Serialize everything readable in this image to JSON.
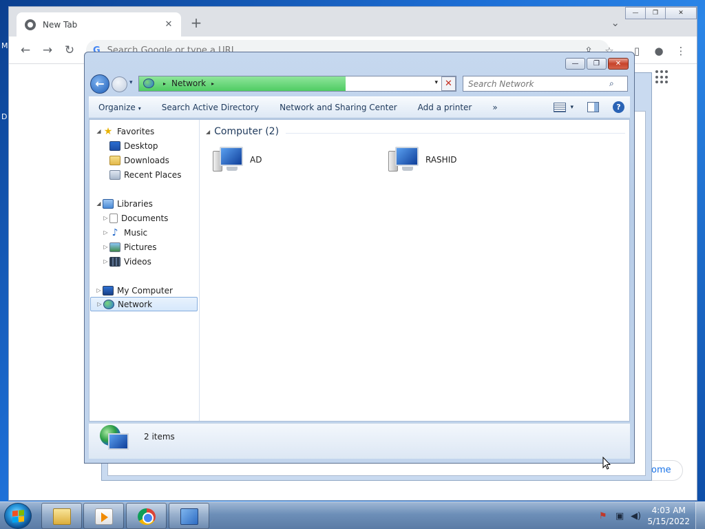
{
  "desktop": {
    "edge_text_top": "M",
    "edge_text_mid": "D"
  },
  "chrome": {
    "tab_title": "New Tab",
    "tab_close": "✕",
    "new_tab": "+",
    "tab_search": "⌄",
    "win_min": "—",
    "win_max": "❐",
    "win_close": "✕",
    "nav_back": "←",
    "nav_forward": "→",
    "nav_reload": "↻",
    "omnibox_placeholder": "Search Google or type a URL",
    "omnibox_g": "G",
    "share_icon": "⇪",
    "star_icon": "☆",
    "sidepanel_icon": "▯",
    "profile_icon": "●",
    "menu_icon": "⋮",
    "customize_label": "rome"
  },
  "explorer": {
    "win_min": "—",
    "win_max": "❐",
    "win_close": "✕",
    "back": "←",
    "history_caret": "▾",
    "address": {
      "location": "Network",
      "sep": "▸",
      "dropdown": "▾",
      "stop": "✕"
    },
    "search_placeholder": "Search Network",
    "search_icon": "⌕",
    "commands": {
      "organize": "Organize",
      "organize_caret": "▾",
      "search_ad": "Search Active Directory",
      "network_center": "Network and Sharing Center",
      "add_printer": "Add a printer",
      "more": "»",
      "view_caret": "▾",
      "help": "?"
    },
    "nav": {
      "favorites": "Favorites",
      "desktop": "Desktop",
      "downloads": "Downloads",
      "recent": "Recent Places",
      "libraries": "Libraries",
      "documents": "Documents",
      "music": "Music",
      "pictures": "Pictures",
      "videos": "Videos",
      "my_computer": "My Computer",
      "network": "Network",
      "expanded": "◢",
      "collapsed": "▷",
      "star": "★",
      "note": "♪"
    },
    "group": {
      "expanded": "◢",
      "title": "Computer (2)"
    },
    "computers": [
      "AD",
      "RASHID"
    ],
    "details": {
      "count": "2 items"
    }
  },
  "taskbar": {
    "tray_flag": "⚑",
    "tray_network": "▣",
    "tray_volume": "◀)",
    "time": "4:03 AM",
    "date": "5/15/2022"
  }
}
